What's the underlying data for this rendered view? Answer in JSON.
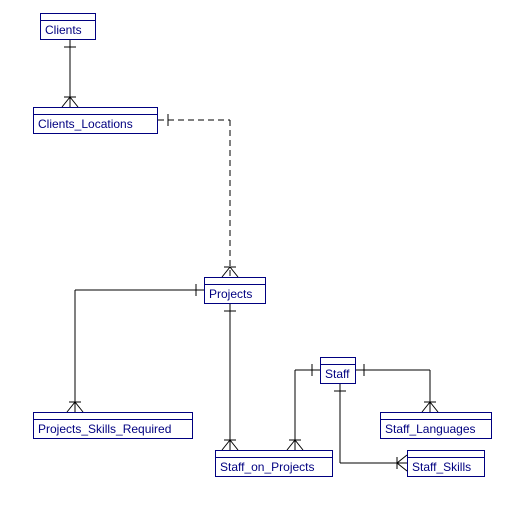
{
  "entities": {
    "clients": "Clients",
    "clients_locations": "Clients_Locations",
    "projects": "Projects",
    "staff": "Staff",
    "projects_skills_required": "Projects_Skills_Required",
    "staff_on_projects": "Staff_on_Projects",
    "staff_languages": "Staff_Languages",
    "staff_skills": "Staff_Skills"
  }
}
